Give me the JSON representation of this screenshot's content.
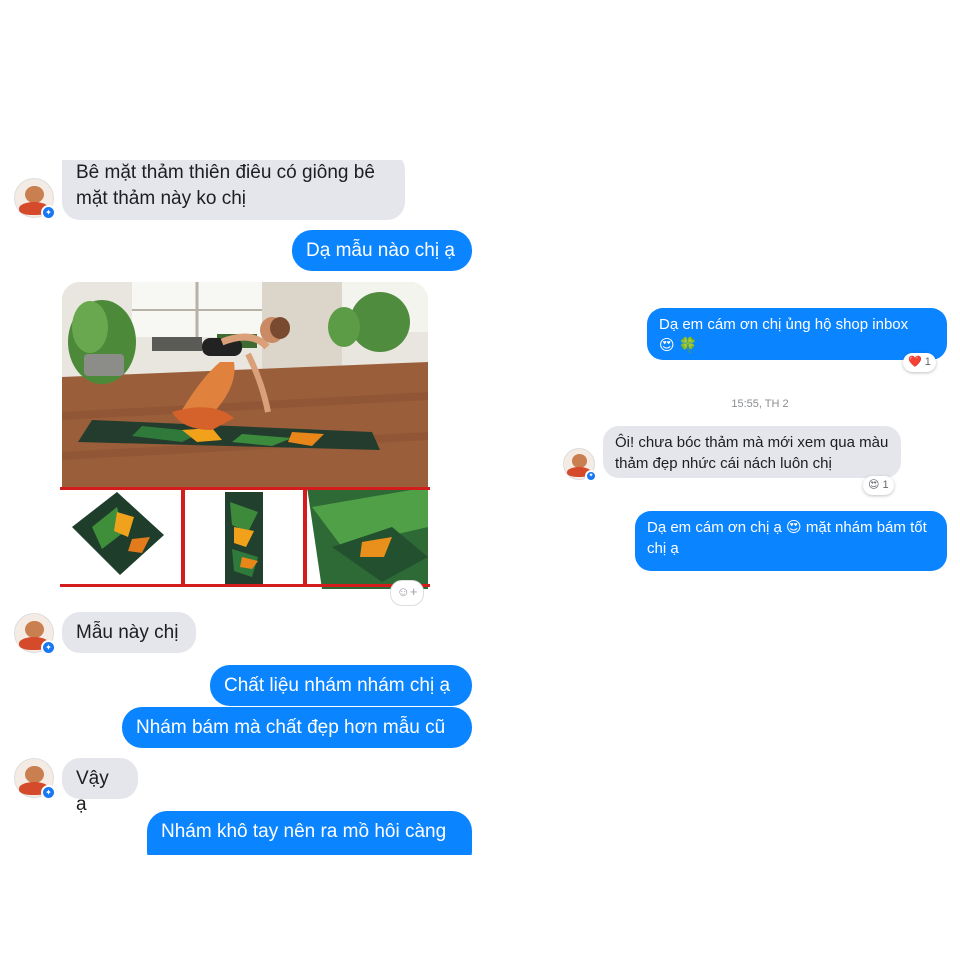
{
  "left_chat": {
    "messages": [
      {
        "from": "them",
        "text": "Bê mặt thảm thiên điêu có giông bê mặt thảm này ko chị"
      },
      {
        "from": "me",
        "text": "Dạ mẫu nào chị ạ"
      },
      {
        "from": "them",
        "text": "Mẫu này chị"
      },
      {
        "from": "me",
        "text": "Chất liệu nhám nhám chị ạ"
      },
      {
        "from": "me",
        "text": "Nhám bám mà chất đẹp hơn mẫu cũ"
      },
      {
        "from": "them",
        "text": "Vậy ạ"
      },
      {
        "from": "me",
        "text": "Nhám khô tay nên ra mồ hôi càng"
      }
    ],
    "react_button_icon": "add-reaction-icon"
  },
  "right_chat": {
    "messages": [
      {
        "from": "me",
        "text": "Dạ em cám ơn chị ủng hộ shop inbox",
        "emoji": "😍 🍀",
        "reaction": {
          "emoji": "❤️",
          "count": "1"
        }
      },
      {
        "from": "them",
        "text": "Ôi! chưa bóc thảm mà mới xem qua màu thảm đẹp nhức cái nách luôn chị",
        "reaction": {
          "emoji": "😍",
          "count": "1"
        }
      },
      {
        "from": "me",
        "text": "Dạ em cám ơn chị ạ 😍 mặt nhám bám tốt chị ạ"
      }
    ],
    "timestamp": "15:55, TH 2"
  },
  "colors": {
    "outgoing_bubble": "#0a84ff",
    "incoming_bubble": "#e4e6eb",
    "thumbnail_border": "#d31c1c"
  }
}
